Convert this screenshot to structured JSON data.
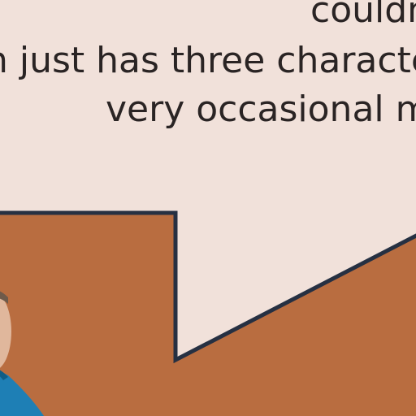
{
  "caption": {
    "line_1": "couldn",
    "line_2": "n just has three character",
    "line_3": "very occasional mo"
  },
  "colors": {
    "bubble_fill": "#f1e1da",
    "bubble_stroke": "#263042",
    "background": "#b96d40",
    "shirt": "#1e7fb5",
    "skin": "#e0b79c",
    "text": "#2a2424"
  }
}
